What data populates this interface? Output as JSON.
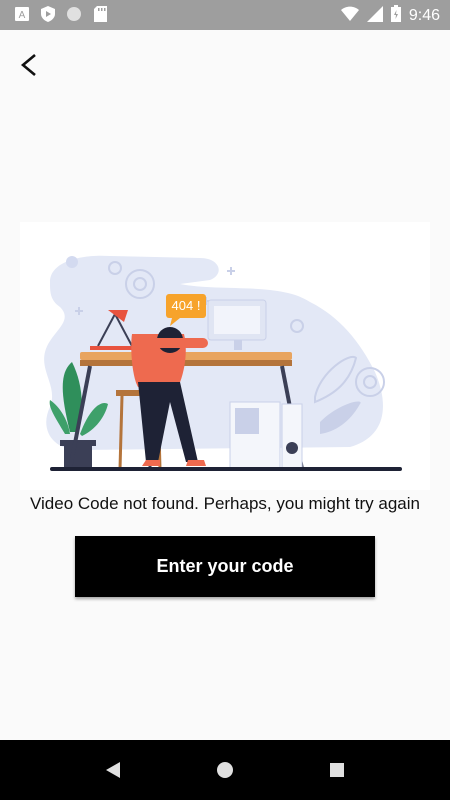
{
  "status_bar": {
    "time": "9:46",
    "left_icons": [
      "text-icon",
      "shield-play-icon",
      "circle-icon",
      "sd-card-icon"
    ],
    "right_icons": [
      "wifi-icon",
      "signal-icon",
      "battery-icon"
    ]
  },
  "top_bar": {
    "back_icon": "back-arrow-icon"
  },
  "illustration": {
    "badge_text": "404 !"
  },
  "message": "Video Code not found. Perhaps, you might try again",
  "button": {
    "label": "Enter your code"
  },
  "nav_bar": {
    "icons": [
      "nav-back-icon",
      "nav-home-icon",
      "nav-recents-icon"
    ]
  },
  "colors": {
    "accent": "#000000",
    "badge": "#f7a32b",
    "lamp": "#e8533f",
    "shirt": "#ee6a4f",
    "background_blob": "#e3e8f6"
  }
}
